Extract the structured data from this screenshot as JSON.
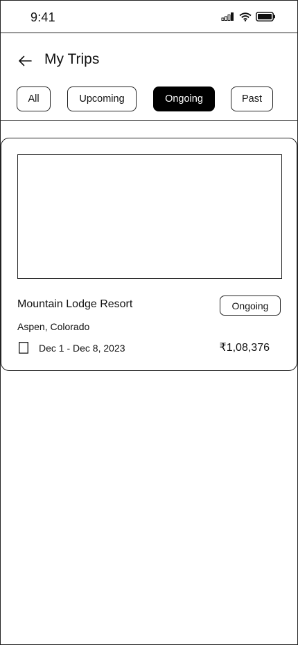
{
  "status_bar": {
    "time": "9:41",
    "icons": [
      "signal-icon",
      "wifi-icon",
      "battery-icon"
    ]
  },
  "header": {
    "title": "My Trips",
    "back_icon": "arrow-left-icon"
  },
  "tabs": [
    {
      "label": "All",
      "active": false
    },
    {
      "label": "Upcoming",
      "active": false
    },
    {
      "label": "Ongoing",
      "active": true
    },
    {
      "label": "Past",
      "active": false
    }
  ],
  "trips": [
    {
      "name": "Mountain Lodge Resort",
      "status": "Ongoing",
      "location": "Aspen, Colorado",
      "dates": "Dec 1 - Dec 8, 2023",
      "price": "₹1,08,376",
      "date_icon": "calendar-icon"
    }
  ],
  "colors": {
    "active_tab_bg": "#000000",
    "active_tab_text": "#ffffff",
    "border": "#222222"
  }
}
